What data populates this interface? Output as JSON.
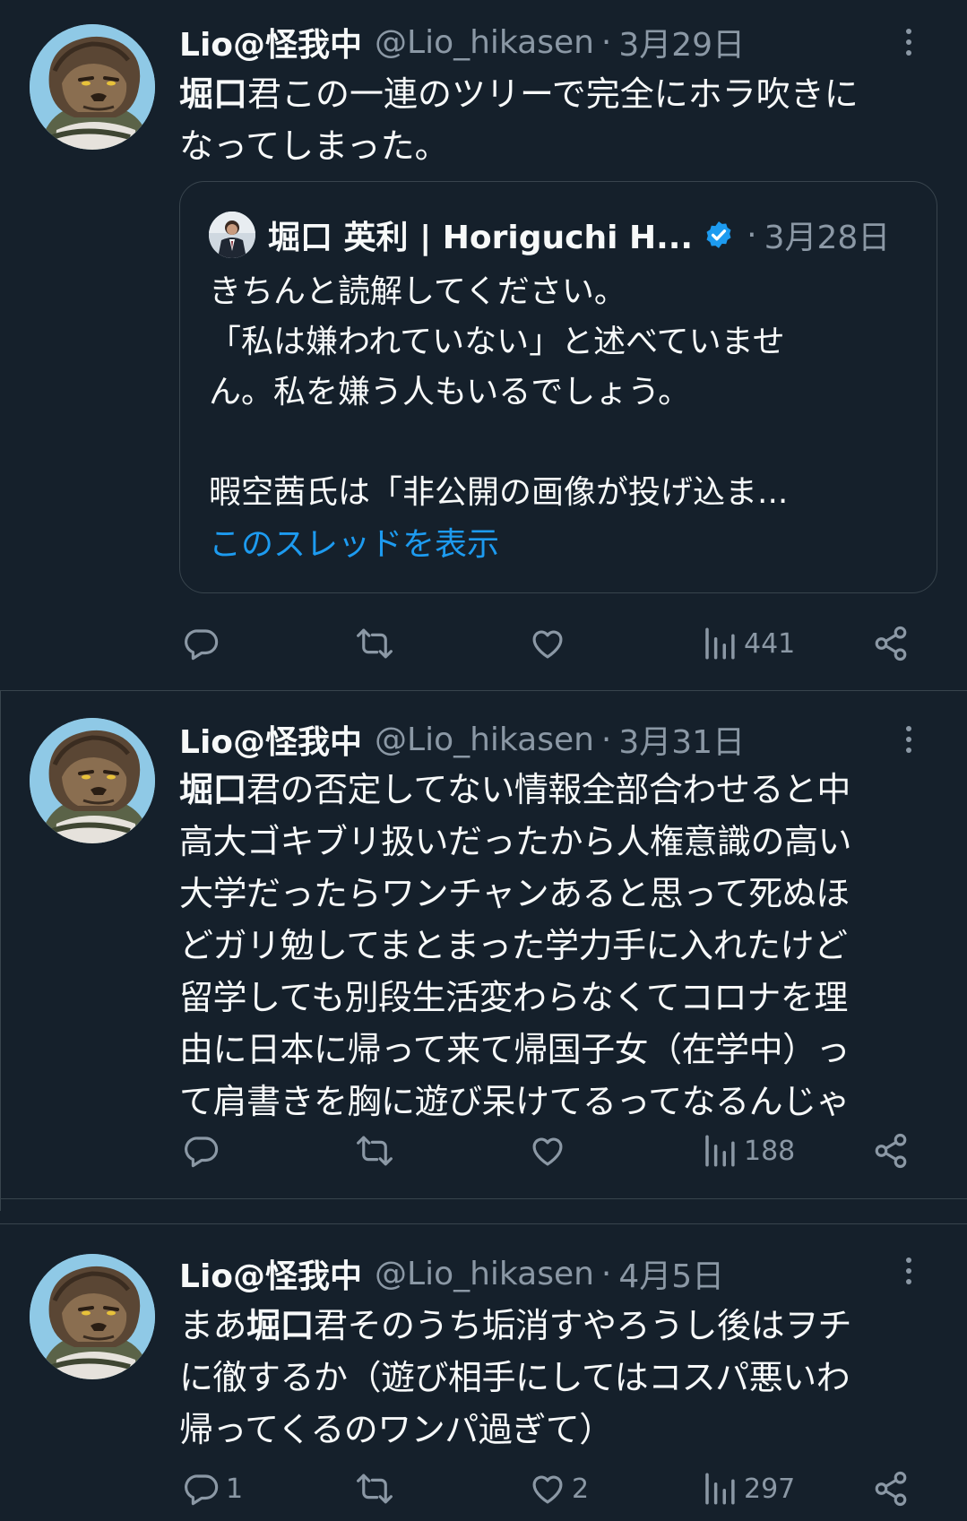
{
  "tweets": [
    {
      "name": "Lio@怪我中",
      "handle": "@Lio_hikasen",
      "dot": "·",
      "date": "3月29日",
      "text_bold": "堀口",
      "text_rest": "君この一連のツリーで完全にホラ吹きに\nなってしまった。",
      "quote": {
        "name": "堀口 英利 | Horiguchi H...",
        "dot": "·",
        "date": "3月28日",
        "text": "きちんと読解してください。\n「私は嫌われていない」と述べていませ\nん。私を嫌う人もいるでしょう。\n\n暇空茜氏は「非公開の画像が投げ込ま...",
        "link": "このスレッドを表示"
      },
      "replies": "",
      "retweets": "",
      "likes": "",
      "views": "441"
    },
    {
      "name": "Lio@怪我中",
      "handle": "@Lio_hikasen",
      "dot": "·",
      "date": "3月31日",
      "text_bold": "堀口",
      "text_rest": "君の否定してない情報全部合わせると中\n高大ゴキブリ扱いだったから人権意識の高い\n大学だったらワンチャンあると思って死ぬほ\nどガリ勉してまとまった学力手に入れたけど\n留学しても別段生活変わらなくてコロナを理\n由に日本に帰って来て帰国子女（在学中）っ\nて肩書きを胸に遊び呆けてるってなるんじゃ",
      "replies": "",
      "retweets": "",
      "likes": "",
      "views": "188"
    },
    {
      "name": "Lio@怪我中",
      "handle": "@Lio_hikasen",
      "dot": "·",
      "date": "4月5日",
      "text_pre": "まあ",
      "text_bold": "堀口",
      "text_rest": "君そのうち垢消すやろうし後はヲチ\nに徹するか（遊び相手にしてはコスパ悪いわ\n帰ってくるのワンパ過ぎて）",
      "replies": "1",
      "retweets": "",
      "likes": "2",
      "views": "297"
    }
  ],
  "icons": {
    "reply": "reply-icon",
    "retweet": "retweet-icon",
    "like": "heart-icon",
    "views": "views-icon",
    "share": "share-icon",
    "more": "more-icon",
    "verified": "verified-badge-icon"
  },
  "colors": {
    "background": "#15202b",
    "text": "#f7f9f9",
    "secondary": "#8b98a5",
    "link": "#1d9bf0",
    "border": "#38444d"
  }
}
